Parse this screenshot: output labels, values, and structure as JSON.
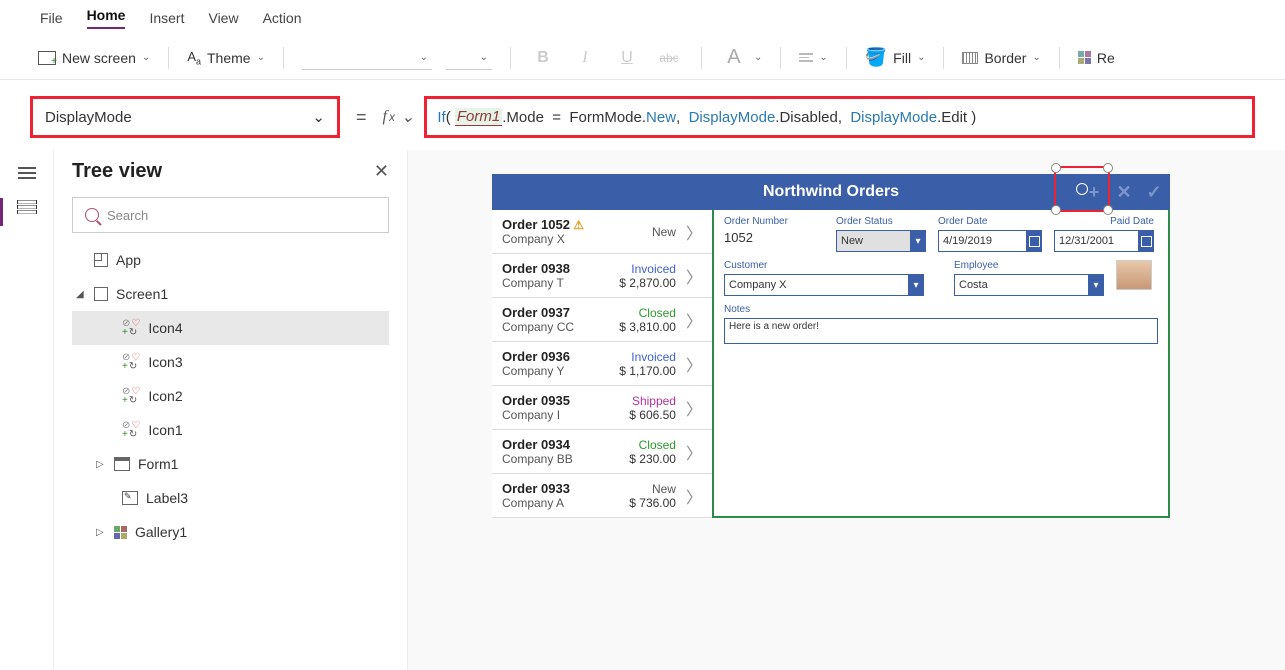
{
  "menu": {
    "file": "File",
    "home": "Home",
    "insert": "Insert",
    "view": "View",
    "action": "Action"
  },
  "ribbon": {
    "new_screen": "New screen",
    "theme": "Theme",
    "fill": "Fill",
    "border": "Border",
    "reorder": "Re"
  },
  "property_selector": "DisplayMode",
  "formula": {
    "fn": "If",
    "ref": "Form1",
    "p1": ".Mode  =  FormMode.",
    "e1": "New",
    "c": ",  ",
    "d1": "DisplayMode",
    "d1b": ".Disabled,  ",
    "d2": "DisplayMode",
    "d2b": ".Edit "
  },
  "tree_title": "Tree view",
  "search_placeholder": "Search",
  "tree": {
    "app": "App",
    "screen1": "Screen1",
    "icon4": "Icon4",
    "icon3": "Icon3",
    "icon2": "Icon2",
    "icon1": "Icon1",
    "form1": "Form1",
    "label3": "Label3",
    "gallery1": "Gallery1"
  },
  "app_title": "Northwind Orders",
  "orders": [
    {
      "title": "Order 1052",
      "company": "Company X",
      "status": "New",
      "status_cls": "st-new",
      "amount": "",
      "warn": true
    },
    {
      "title": "Order 0938",
      "company": "Company T",
      "status": "Invoiced",
      "status_cls": "st-invoiced",
      "amount": "$ 2,870.00"
    },
    {
      "title": "Order 0937",
      "company": "Company CC",
      "status": "Closed",
      "status_cls": "st-closed",
      "amount": "$ 3,810.00"
    },
    {
      "title": "Order 0936",
      "company": "Company Y",
      "status": "Invoiced",
      "status_cls": "st-invoiced",
      "amount": "$ 1,170.00"
    },
    {
      "title": "Order 0935",
      "company": "Company I",
      "status": "Shipped",
      "status_cls": "st-shipped",
      "amount": "$ 606.50"
    },
    {
      "title": "Order 0934",
      "company": "Company BB",
      "status": "Closed",
      "status_cls": "st-closed",
      "amount": "$ 230.00"
    },
    {
      "title": "Order 0933",
      "company": "Company A",
      "status": "New",
      "status_cls": "st-new",
      "amount": "$ 736.00"
    }
  ],
  "form": {
    "order_number_label": "Order Number",
    "order_number": "1052",
    "order_status_label": "Order Status",
    "order_status": "New",
    "order_date_label": "Order Date",
    "order_date": "4/19/2019",
    "paid_date_label": "Paid Date",
    "paid_date": "12/31/2001",
    "customer_label": "Customer",
    "customer": "Company X",
    "employee_label": "Employee",
    "employee": "Costa",
    "notes_label": "Notes",
    "notes": "Here is a new order!"
  }
}
